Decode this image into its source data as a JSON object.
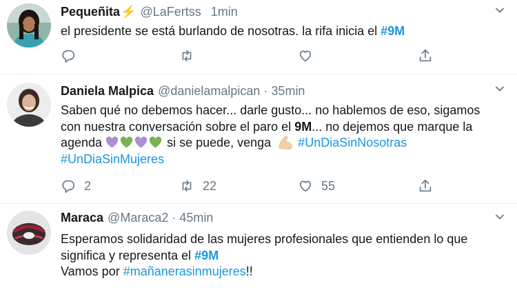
{
  "tweets": [
    {
      "name": "Pequeñita",
      "name_emoji": "⚡",
      "handle": "@LaFertss",
      "time": "1min",
      "text_before": "el presidente se está burlando de nosotras. la rifa inicia el ",
      "hashtag": "#9M",
      "replies": "",
      "retweets": "",
      "likes": ""
    },
    {
      "name": "Daniela Malpica",
      "handle": "@danielamalpican",
      "dot": "·",
      "time": "35min",
      "text_part1": "Saben qué no debemos hacer... darle gusto... no hablemos de eso, sigamos con nuestra conversación sobre el paro el ",
      "bold_word": "9M",
      "text_part2": "... no dejemos que marque la agenda ",
      "text_part3": " si se puede, venga ",
      "hashtag1": "#UnDiaSinNosotras",
      "hashtag2": "#UnDiaSinMujeres",
      "replies": "2",
      "retweets": "22",
      "likes": "55"
    },
    {
      "name": "Maraca",
      "handle": "@Maraca2",
      "dot": "·",
      "time": "45min",
      "line1_text": "Esperamos solidaridad de las mujeres profesionales que entienden lo que significa y representa el ",
      "line1_tag": "#9M",
      "line2_text": "Vamos por ",
      "line2_tag": "#mañanerasinmujeres",
      "line2_end": "!!"
    }
  ],
  "colors": {
    "text": "#14171a",
    "secondary": "#657786",
    "link": "#1b95e0",
    "divider": "#e6ecf0"
  },
  "icons": [
    "reply-icon",
    "retweet-icon",
    "like-icon",
    "share-icon",
    "caret-down-icon"
  ]
}
